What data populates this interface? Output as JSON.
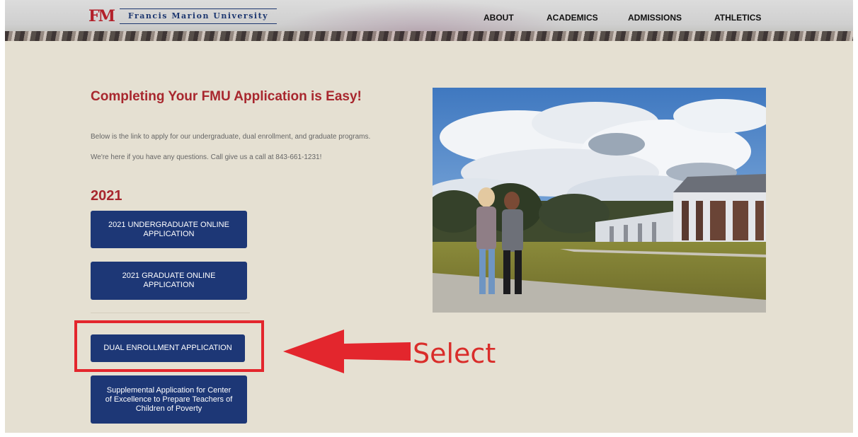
{
  "header": {
    "logo_mark": "FM",
    "university_name": "Francis Marion University",
    "nav": [
      "ABOUT",
      "ACADEMICS",
      "ADMISSIONS",
      "ATHLETICS"
    ]
  },
  "main": {
    "heading": "Completing Your FMU Application is Easy!",
    "paragraphs": [
      "Below is the link to apply for our undergraduate, dual enrollment, and graduate programs.",
      "We're here if you have any questions. Call give us a call at 843-661-1231!"
    ],
    "year": "2021",
    "buttons": [
      "2021 UNDERGRADUATE ONLINE APPLICATION",
      "2021 GRADUATE ONLINE APPLICATION",
      "DUAL ENROLLMENT APPLICATION",
      "Supplemental Application for Center of Excellence to Prepare Teachers of Children of Poverty"
    ]
  },
  "annotation": {
    "label": "Select",
    "color": "#e3262d"
  },
  "colors": {
    "brand_red": "#a8272e",
    "brand_navy": "#1d3776",
    "background": "#e5e0d2"
  }
}
